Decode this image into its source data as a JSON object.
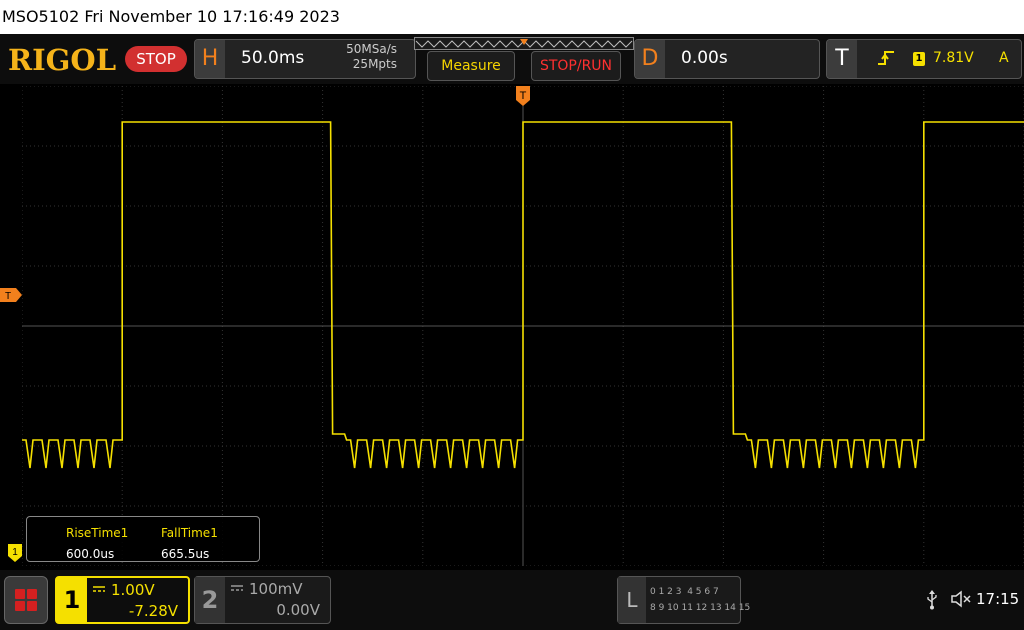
{
  "title_bar": {
    "text": "MSO5102  Fri November 10 17:16:49 2023"
  },
  "toolbar": {
    "logo": "RIGOL",
    "run_state": "STOP",
    "horizontal": {
      "letter": "H",
      "timebase": "50.0ms",
      "sample_rate": "50MSa/s",
      "memory_depth": "25Mpts"
    },
    "measure_label": "Measure",
    "stop_run_label": "STOP/RUN",
    "delay": {
      "letter": "D",
      "value": "0.00s"
    },
    "trigger": {
      "letter": "T",
      "slope_icon": "rising-edge-icon",
      "source": "1",
      "level": "7.81V",
      "mode": "A"
    }
  },
  "screen": {
    "grid": {
      "h_divisions": 10,
      "v_divisions": 8
    },
    "trigger_marker_label": "T",
    "trigger_level_label": "T",
    "channel1_marker_label": "1",
    "waveform": {
      "color": "#f5e000",
      "period_ms": 200,
      "high_level_div": 3.4,
      "low_level_div": -1.9
    }
  },
  "measurements": [
    {
      "label": "RiseTime1",
      "value": "600.0us"
    },
    {
      "label": "FallTime1",
      "value": "665.5us"
    }
  ],
  "bottom_bar": {
    "channel1": {
      "number": "1",
      "scale": "1.00V",
      "offset": "-7.28V",
      "color": "#f5e000"
    },
    "channel2": {
      "number": "2",
      "scale": "100mV",
      "offset": "0.00V"
    },
    "logic": {
      "letter": "L",
      "row1": "0 1 2 3  4 5 6 7",
      "row2": "8 9 10 11 12 13 14 15"
    },
    "time": "17:15"
  }
}
